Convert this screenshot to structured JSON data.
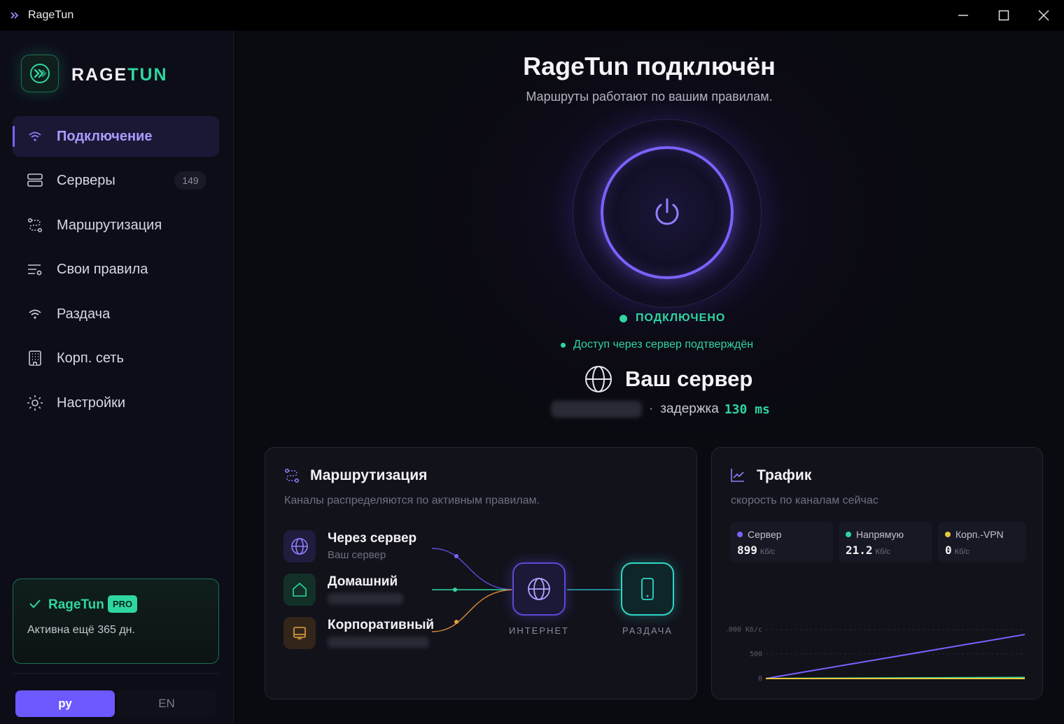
{
  "window": {
    "title": "RageTun"
  },
  "sidebar": {
    "logo_prefix": "RAGE",
    "logo_suffix": "TUN",
    "items": [
      {
        "label": "Подключение",
        "icon": "wifi-icon",
        "active": true
      },
      {
        "label": "Серверы",
        "icon": "server-icon",
        "badge": "149"
      },
      {
        "label": "Маршрутизация",
        "icon": "route-icon"
      },
      {
        "label": "Свои правила",
        "icon": "rules-icon"
      },
      {
        "label": "Раздача",
        "icon": "hotspot-icon"
      },
      {
        "label": "Корп. сеть",
        "icon": "building-icon"
      },
      {
        "label": "Настройки",
        "icon": "settings-icon"
      }
    ],
    "pro": {
      "name": "RageTun",
      "badge": "PRO",
      "status": "Активна ещё 365 дн."
    },
    "languages": {
      "ru": "ру",
      "en": "EN",
      "selected": "ру"
    }
  },
  "main": {
    "title": "RageTun подключён",
    "subtitle": "Маршруты работают по вашим правилам.",
    "status": "ПОДКЛЮЧЕНО",
    "access": "Доступ через сервер подтверждён",
    "server_name": "Ваш сервер",
    "latency_label": "задержка",
    "latency_value": "130 ms",
    "separator": "·"
  },
  "routing_card": {
    "title": "Маршрутизация",
    "subtitle": "Каналы распределяются по активным правилам.",
    "routes": [
      {
        "title": "Через сервер",
        "sub": "Ваш сервер",
        "icon": "globe-icon"
      },
      {
        "title": "Домашний",
        "icon": "home-icon"
      },
      {
        "title": "Корпоративный",
        "icon": "laptop-icon"
      }
    ],
    "nodes": {
      "internet": "ИНТЕРНЕТ",
      "share": "РАЗДАЧА"
    }
  },
  "traffic_card": {
    "title": "Трафик",
    "subtitle": "скорость по каналам сейчас",
    "metrics": [
      {
        "name": "Сервер",
        "value": "899",
        "unit": "Кб/с",
        "color": "#7a63ff"
      },
      {
        "name": "Напрямую",
        "value": "21.2",
        "unit": "Кб/с",
        "color": "#2fd6a0"
      },
      {
        "name": "Корп.-VPN",
        "value": "0",
        "unit": "Кб/с",
        "color": "#e6c93a"
      }
    ]
  },
  "chart_data": {
    "type": "line",
    "y_ticks": [
      "1000 Кб/с",
      "500",
      "0"
    ],
    "ylim": [
      0,
      1000
    ],
    "grid": true,
    "series": [
      {
        "name": "Сервер",
        "color": "#7a63ff",
        "values": [
          0,
          899
        ]
      },
      {
        "name": "Напрямую",
        "color": "#2fd6a0",
        "values": [
          0,
          21.2
        ]
      },
      {
        "name": "Корп.-VPN",
        "color": "#e6c93a",
        "values": [
          0,
          0
        ]
      }
    ]
  },
  "colors": {
    "accent": "#7a63ff",
    "success": "#2fd6a0"
  }
}
